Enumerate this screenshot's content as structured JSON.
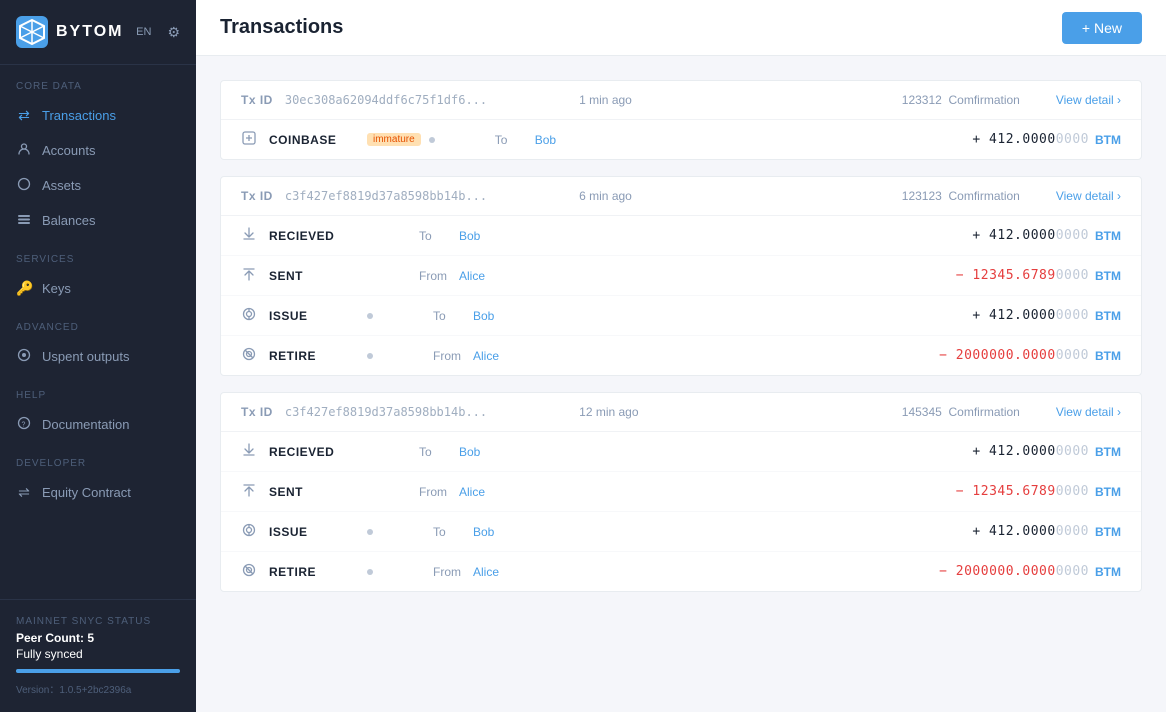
{
  "app": {
    "logo": "BYTOM",
    "lang": "EN",
    "page_title": "Transactions",
    "new_button": "+ New"
  },
  "sidebar": {
    "sections": [
      {
        "label": "CORE DATA",
        "items": [
          {
            "id": "transactions",
            "label": "Transactions",
            "icon": "⇄",
            "active": true
          },
          {
            "id": "accounts",
            "label": "Accounts",
            "icon": "○",
            "active": false
          },
          {
            "id": "assets",
            "label": "Assets",
            "icon": "◇",
            "active": false
          },
          {
            "id": "balances",
            "label": "Balances",
            "icon": "▤",
            "active": false
          }
        ]
      },
      {
        "label": "SERVICES",
        "items": [
          {
            "id": "keys",
            "label": "Keys",
            "icon": "⚿",
            "active": false
          }
        ]
      },
      {
        "label": "ADVANCED",
        "items": [
          {
            "id": "unspent",
            "label": "Uspent outputs",
            "icon": "⊙",
            "active": false
          }
        ]
      },
      {
        "label": "HELP",
        "items": [
          {
            "id": "docs",
            "label": "Documentation",
            "icon": "⊕",
            "active": false
          }
        ]
      },
      {
        "label": "DEVELOPER",
        "items": [
          {
            "id": "equity",
            "label": "Equity Contract",
            "icon": "⇌",
            "active": false
          }
        ]
      }
    ],
    "sync": {
      "label": "MAINNET SNYC STATUS",
      "peer": "Peer Count: 5",
      "status": "Fully synced",
      "progress": 100
    },
    "version": "Version：1.0.5+2bc2396a"
  },
  "transactions": [
    {
      "tx_id": "30ec308a62094ddf6c75f1df6...",
      "time": "1 min ago",
      "confirmations": "123312",
      "confirmation_label": "Comfirmation",
      "view_detail": "View detail",
      "rows": [
        {
          "icon": "coinbase",
          "type": "COINBASE",
          "tag": "immature",
          "has_dot": true,
          "direction": "To",
          "address": "Bob",
          "amount_sign": "+",
          "amount_main": " 412.0000",
          "amount_trailing": "0000",
          "currency": "BTM",
          "is_positive": true
        }
      ]
    },
    {
      "tx_id": "c3f427ef8819d37a8598bb14b...",
      "time": "6 min ago",
      "confirmations": "123123",
      "confirmation_label": "Comfirmation",
      "view_detail": "View detail",
      "rows": [
        {
          "icon": "received",
          "type": "RECIEVED",
          "tag": "",
          "has_dot": false,
          "direction": "To",
          "address": "Bob",
          "amount_sign": "+",
          "amount_main": " 412.0000",
          "amount_trailing": "0000",
          "currency": "BTM",
          "is_positive": true
        },
        {
          "icon": "sent",
          "type": "SENT",
          "tag": "",
          "has_dot": false,
          "direction": "From",
          "address": "Alice",
          "amount_sign": "−",
          "amount_main": " 12345.6789",
          "amount_trailing": "0000",
          "currency": "BTM",
          "is_positive": false
        },
        {
          "icon": "issue",
          "type": "ISSUE",
          "tag": "",
          "has_dot": true,
          "direction": "To",
          "address": "Bob",
          "amount_sign": "+",
          "amount_main": " 412.0000",
          "amount_trailing": "0000",
          "currency": "BTM",
          "is_positive": true
        },
        {
          "icon": "retire",
          "type": "RETIRE",
          "tag": "",
          "has_dot": true,
          "direction": "From",
          "address": "Alice",
          "amount_sign": "−",
          "amount_main": " 2000000.0000",
          "amount_trailing": "0000",
          "currency": "BTM",
          "is_positive": false
        }
      ]
    },
    {
      "tx_id": "c3f427ef8819d37a8598bb14b...",
      "time": "12 min ago",
      "confirmations": "145345",
      "confirmation_label": "Comfirmation",
      "view_detail": "View detail",
      "rows": [
        {
          "icon": "received",
          "type": "RECIEVED",
          "tag": "",
          "has_dot": false,
          "direction": "To",
          "address": "Bob",
          "amount_sign": "+",
          "amount_main": " 412.0000",
          "amount_trailing": "0000",
          "currency": "BTM",
          "is_positive": true
        },
        {
          "icon": "sent",
          "type": "SENT",
          "tag": "",
          "has_dot": false,
          "direction": "From",
          "address": "Alice",
          "amount_sign": "−",
          "amount_main": " 12345.6789",
          "amount_trailing": "0000",
          "currency": "BTM",
          "is_positive": false
        },
        {
          "icon": "issue",
          "type": "ISSUE",
          "tag": "",
          "has_dot": true,
          "direction": "To",
          "address": "Bob",
          "amount_sign": "+",
          "amount_main": " 412.0000",
          "amount_trailing": "0000",
          "currency": "BTM",
          "is_positive": true
        },
        {
          "icon": "retire",
          "type": "RETIRE",
          "tag": "",
          "has_dot": true,
          "direction": "From",
          "address": "Alice",
          "amount_sign": "−",
          "amount_main": " 2000000.0000",
          "amount_trailing": "0000",
          "currency": "BTM",
          "is_positive": false
        }
      ]
    }
  ]
}
